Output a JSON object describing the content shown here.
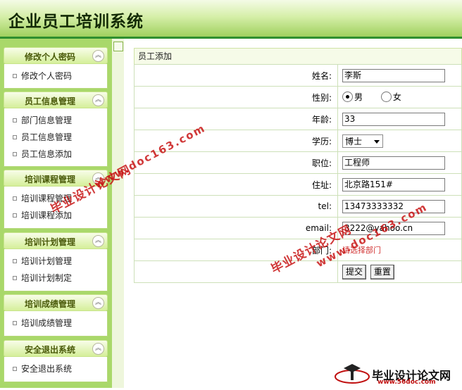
{
  "header": {
    "title": "企业员工培训系统"
  },
  "sidebar": {
    "groups": [
      {
        "label": "修改个人密码",
        "items": [
          "修改个人密码"
        ]
      },
      {
        "label": "员工信息管理",
        "items": [
          "部门信息管理",
          "员工信息管理",
          "员工信息添加"
        ]
      },
      {
        "label": "培训课程管理",
        "items": [
          "培训课程管理",
          "培训课程添加"
        ]
      },
      {
        "label": "培训计划管理",
        "items": [
          "培训计划管理",
          "培训计划制定"
        ]
      },
      {
        "label": "培训成绩管理",
        "items": [
          "培训成绩管理"
        ]
      },
      {
        "label": "安全退出系统",
        "items": [
          "安全退出系统"
        ]
      }
    ],
    "collapse_glyph": "︽"
  },
  "panel": {
    "title": "员工添加"
  },
  "form": {
    "name_label": "姓名:",
    "name_value": "李斯",
    "gender_label": "性别:",
    "gender_male": "男",
    "gender_female": "女",
    "gender_selected": "男",
    "age_label": "年龄:",
    "age_value": "33",
    "education_label": "学历:",
    "education_value": "博士",
    "position_label": "职位:",
    "position_value": "工程师",
    "address_label": "住址:",
    "address_value": "北京路151#",
    "tel_label": "tel:",
    "tel_value": "13473333332",
    "email_label": "email:",
    "email_value": "3222@yahoo.cn",
    "dept_label": "部门:",
    "dept_hint": "请选择部门",
    "submit_label": "提交",
    "reset_label": "重置"
  },
  "watermarks": {
    "site": "www.doc163.com",
    "cn": "毕业设计论文网",
    "logo_text": "毕业设计论文网",
    "logo_url": "www.56doc.com"
  },
  "colors": {
    "accent_green": "#2f8f2f",
    "sidebar_bg": "#a9d86a",
    "watermark_red": "#c81616"
  }
}
